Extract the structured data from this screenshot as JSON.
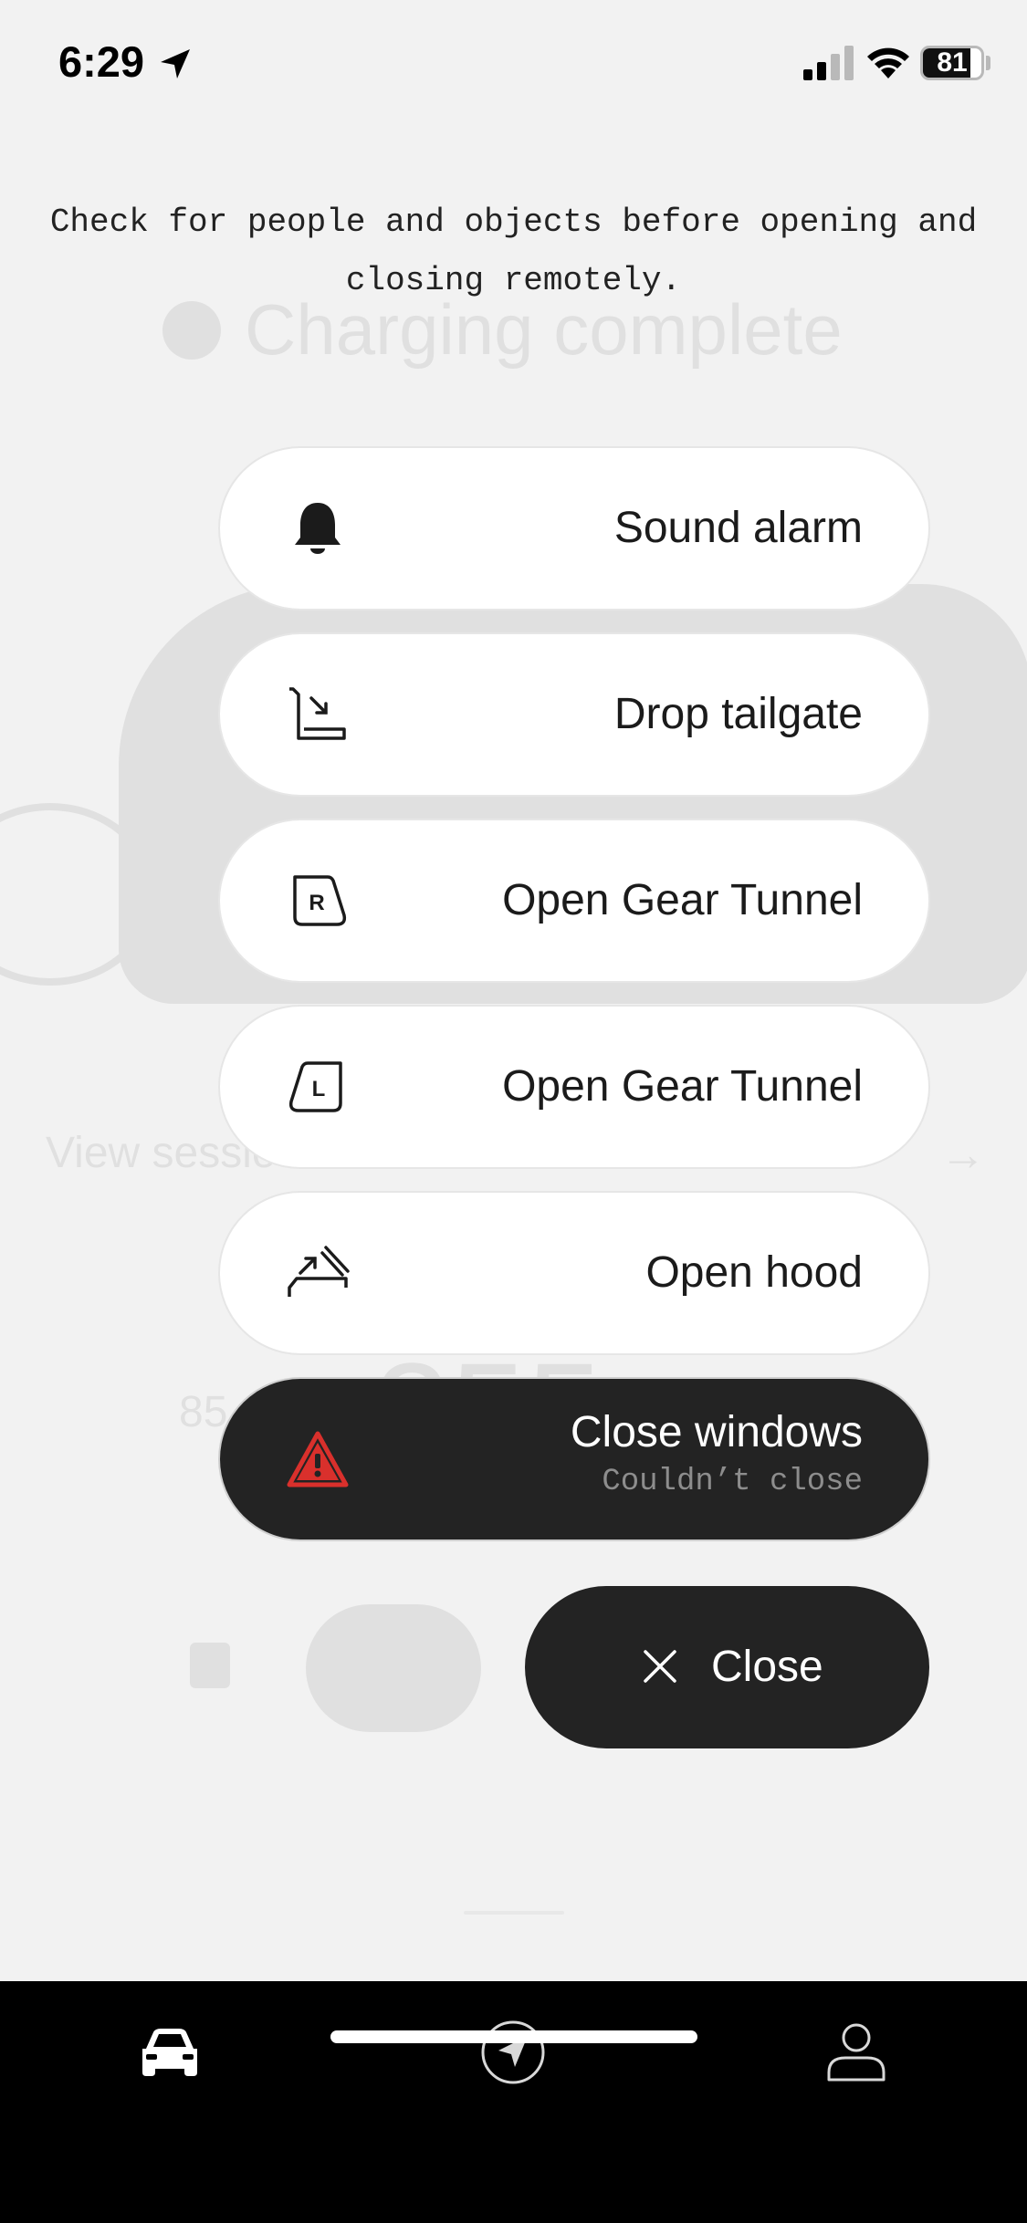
{
  "status_bar": {
    "time": "6:29",
    "battery_level": "81",
    "battery_fraction": 0.81
  },
  "background": {
    "title": "Charging complete",
    "view_session": "View sessio",
    "range_value": "355",
    "range_small": "85"
  },
  "warning": {
    "text": "Check for people and objects before opening and closing remotely."
  },
  "actions": [
    {
      "label": "Sound alarm",
      "icon": "bell-icon"
    },
    {
      "label": "Drop tailgate",
      "icon": "tailgate-icon"
    },
    {
      "label": "Open Gear Tunnel",
      "icon": "gear-tunnel-right-icon",
      "badge": "R"
    },
    {
      "label": "Open Gear Tunnel",
      "icon": "gear-tunnel-left-icon",
      "badge": "L"
    },
    {
      "label": "Open hood",
      "icon": "hood-icon"
    },
    {
      "label": "Close windows",
      "sublabel": "Couldn’t close",
      "icon": "warning-icon",
      "state": "error"
    }
  ],
  "close_button": {
    "label": "Close"
  },
  "tab_bar": {
    "tabs": [
      {
        "name": "vehicle",
        "icon": "car-icon",
        "active": true
      },
      {
        "name": "navigate",
        "icon": "navigation-icon",
        "active": false
      },
      {
        "name": "profile",
        "icon": "profile-icon",
        "active": false
      }
    ]
  },
  "colors": {
    "background": "#f2f2f2",
    "pill": "#ffffff",
    "dark_pill": "#232323",
    "error": "#d9302c",
    "tab_bar": "#000000"
  }
}
